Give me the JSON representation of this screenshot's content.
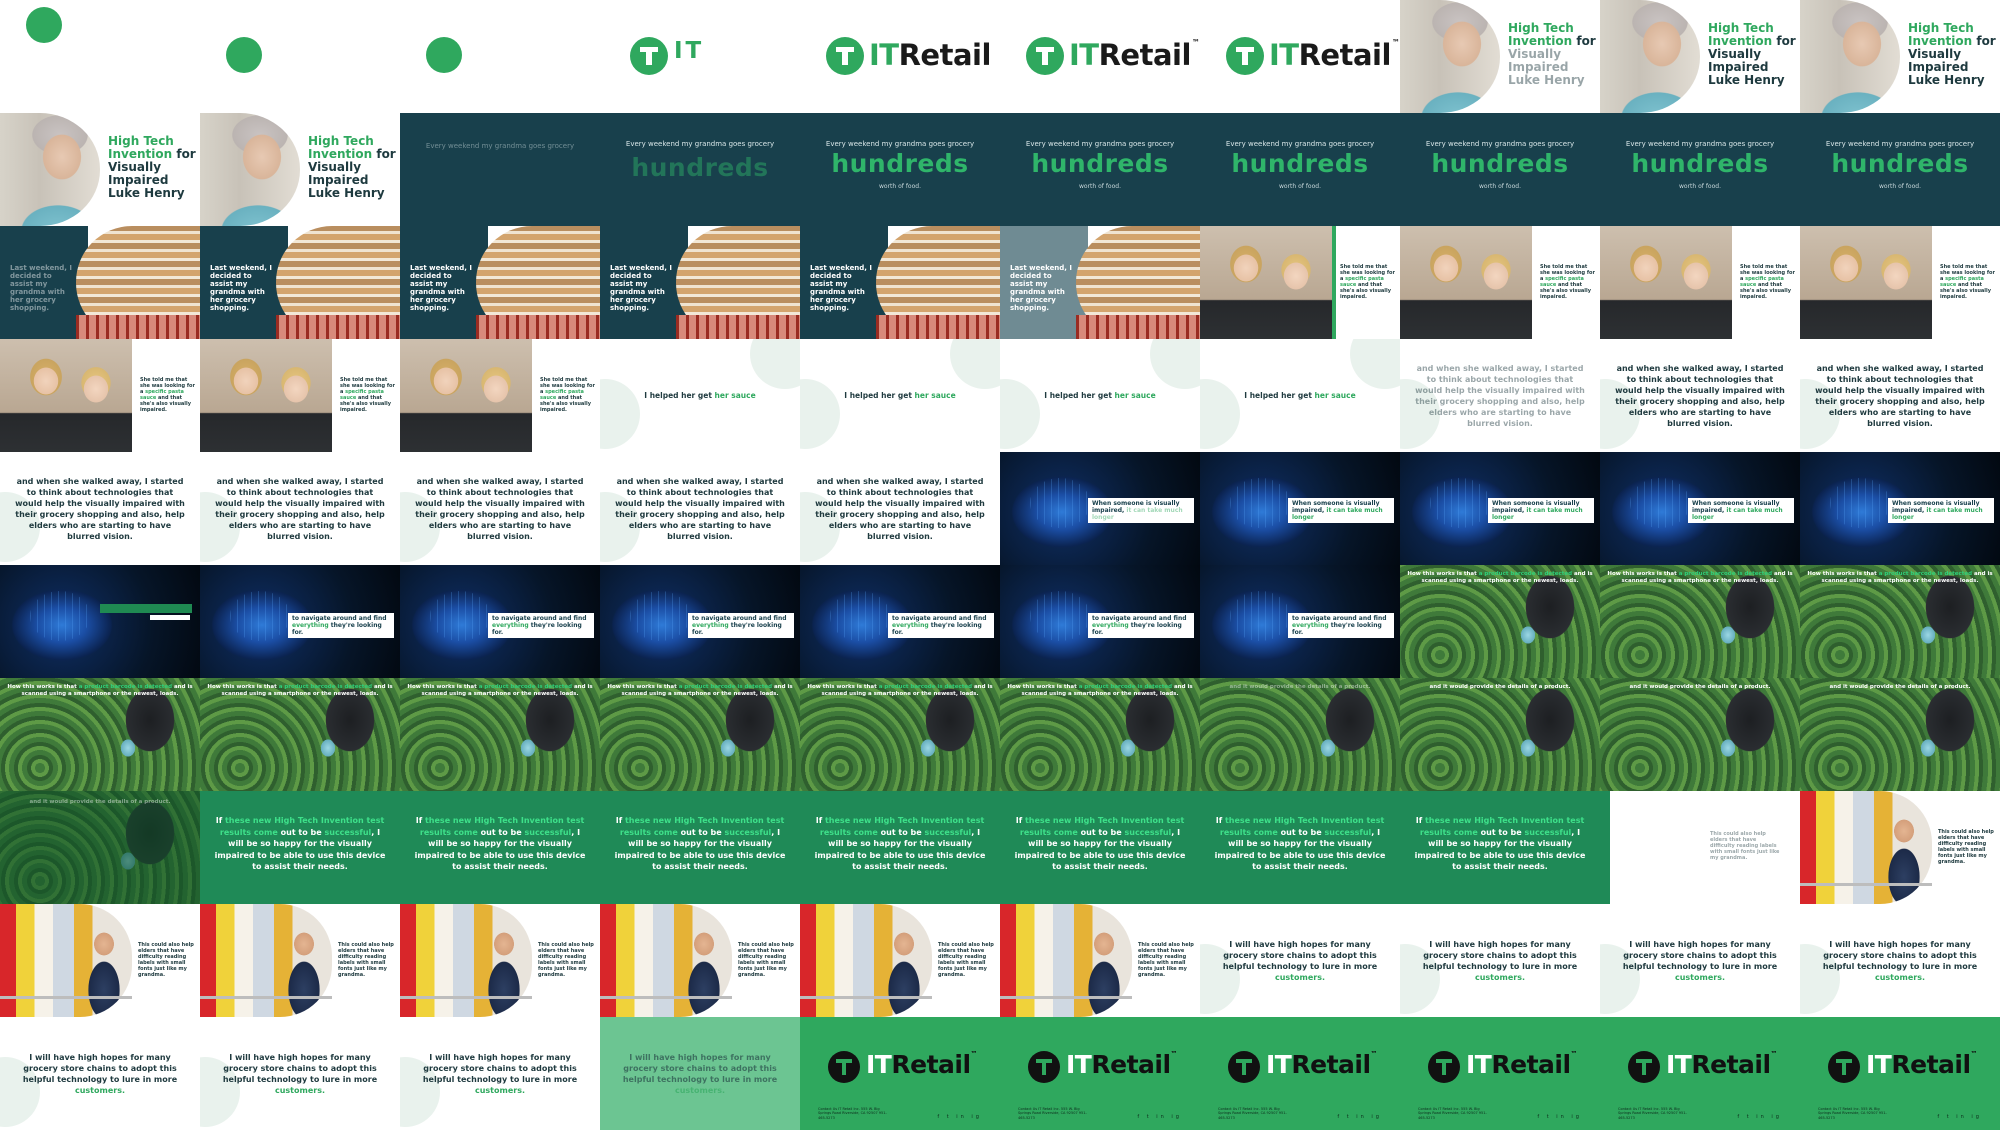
{
  "brand": {
    "logo_it": "IT",
    "logo_rest": "Retail",
    "logo_tm": "™",
    "green": "#2fa85e",
    "teal": "#18404c",
    "dark_green": "#1f8a57"
  },
  "text": {
    "title_lead": "High Tech Invention",
    "title_for": "for",
    "title_tail": "Visually Impaired Luke Henry",
    "every_weekend": "Every weekend my grandma goes grocery",
    "hundreds": "hundreds",
    "worth": "worth of food.",
    "last_weekend": "Last weekend, I decided to assist my grandma with her grocery shopping.",
    "she_told_a": "She told me that she was looking for a",
    "she_told_b": "specific pasta sauce",
    "she_told_c": "and that she's also visually impaired.",
    "helped_a": "I helped her get",
    "helped_b": "her sauce",
    "walked_away": "and when she walked away, I started to think about technologies that would help the visually impaired with their grocery shopping and also, help elders who are starting to have blurred vision.",
    "someone_a": "When someone is visually impaired,",
    "someone_b": "it can take much longer",
    "navigate_a": "to navigate around and find",
    "navigate_b": "everything",
    "navigate_c": "they're looking for.",
    "how_a": "How this works is that",
    "how_b": "a product barcode is detected",
    "how_c": "and is scanned using a smartphone or the newest, loads.",
    "provide": "and it would provide the details of a product.",
    "if_a": "If",
    "if_b": "these new High Tech Invention test results come",
    "if_c": "out to be",
    "if_d": "successful",
    "if_e": ", I will be so happy for the visually impaired to be able to use this device to assist their needs.",
    "could_help": "This could also help elders that have difficulty reading labels with small fonts just like my grandma.",
    "hopes_a": "I will have high hopes for many grocery store chains to adopt this helpful technology to lure in more",
    "hopes_b": "customers.",
    "contact": "Contact Us IT Retail Inc. 555 W. Big Springs Road Riverside, CA 92507 951-465-5273",
    "social": "f t in ig"
  }
}
